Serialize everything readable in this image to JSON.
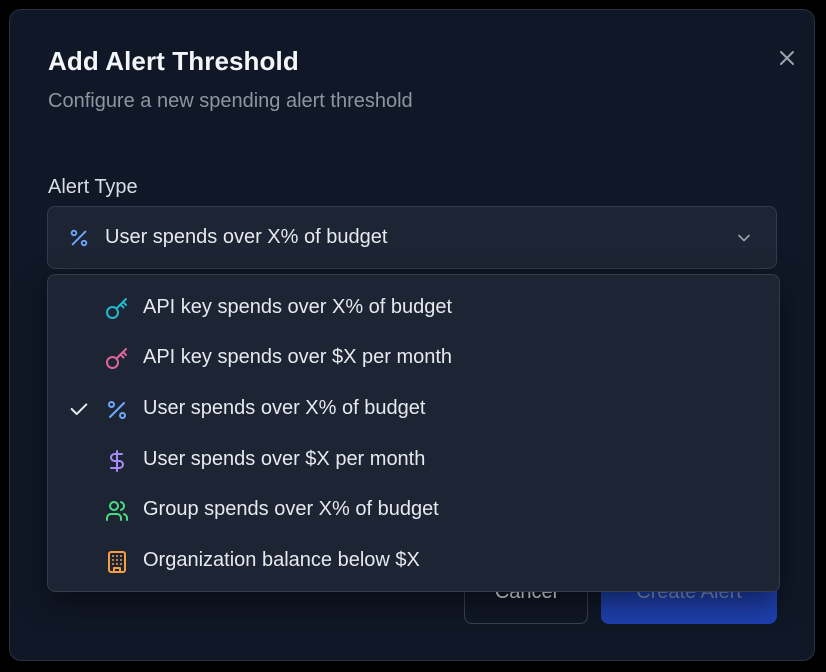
{
  "dialog": {
    "title": "Add Alert Threshold",
    "subtitle": "Configure a new spending alert threshold",
    "close_icon": "x-icon"
  },
  "field": {
    "label": "Alert Type",
    "selected_value": "User spends over X% of budget",
    "selected_icon": "percent-icon"
  },
  "options": [
    {
      "label": "API key spends over X% of budget",
      "icon": "key-icon",
      "color": "#22b8cf",
      "selected": false
    },
    {
      "label": "API key spends over $X per month",
      "icon": "key-icon",
      "color": "#e0649b",
      "selected": false
    },
    {
      "label": "User spends over X% of budget",
      "icon": "percent-icon",
      "color": "#6ea8fe",
      "selected": true
    },
    {
      "label": "User spends over $X per month",
      "icon": "dollar-icon",
      "color": "#a78bfa",
      "selected": false
    },
    {
      "label": "Group spends over X% of budget",
      "icon": "users-icon",
      "color": "#4ade80",
      "selected": false
    },
    {
      "label": "Organization balance below $X",
      "icon": "building-icon",
      "color": "#f59e42",
      "selected": false
    }
  ],
  "buttons": {
    "cancel": "Cancel",
    "create": "Create Alert"
  },
  "colors": {
    "dialog_bg": "#101726",
    "accent_button": "#1e40af"
  }
}
